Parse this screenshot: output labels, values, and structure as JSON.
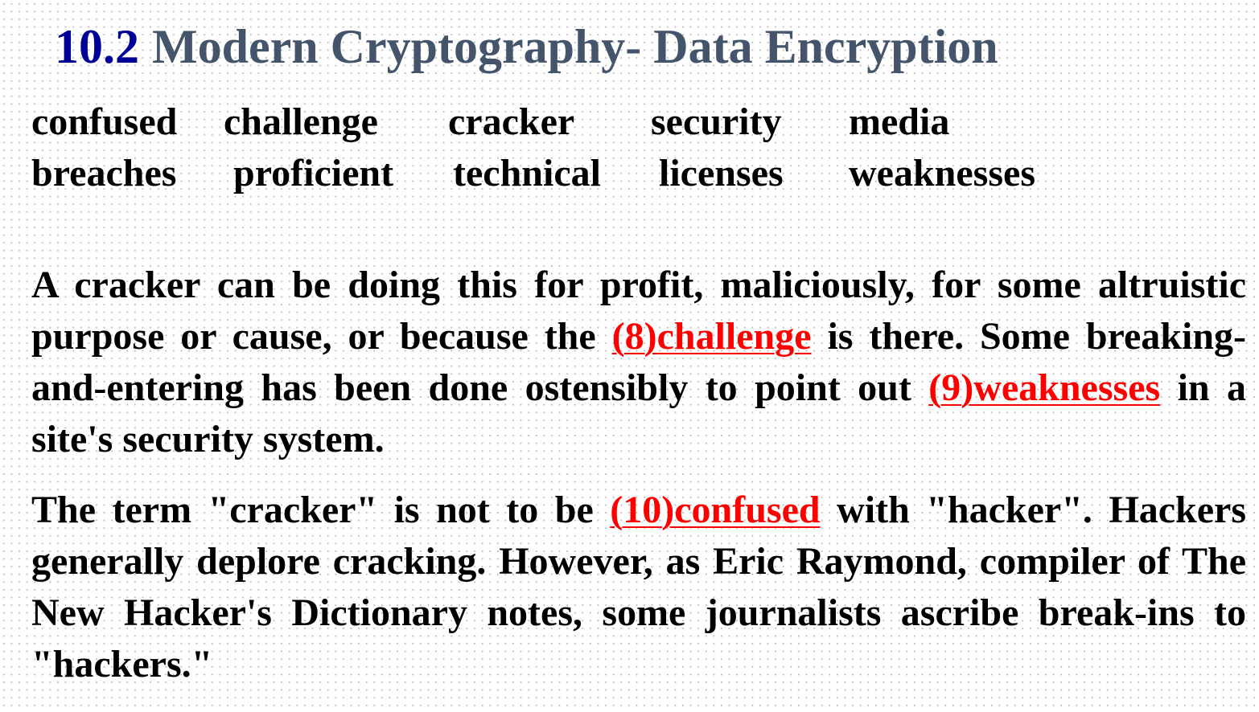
{
  "title": {
    "number": "10.2",
    "text": "Modern Cryptography- Data Encryption"
  },
  "word_bank": {
    "row1": [
      "confused",
      "challenge",
      "cracker",
      "security",
      "media"
    ],
    "row2": [
      "breaches",
      "proficient",
      "technical",
      "licenses",
      "weaknesses"
    ]
  },
  "paragraph1": {
    "part1": "A cracker can be doing this for profit, maliciously, for some altruistic purpose or cause, or because the ",
    "blank8": "(8)challenge",
    "part2": " is there. Some breaking-and-entering has been done ostensibly to point out ",
    "blank9": "(9)weaknesses",
    "part3": " in a site's security system."
  },
  "paragraph2": {
    "part1": "The term \"cracker\" is not to be ",
    "blank10": "(10)confused",
    "part2": " with \"hacker\". Hackers generally deplore cracking. However, as Eric Raymond, compiler of The New Hacker's Dictionary notes, some journalists ascribe break-ins to \"hackers.\""
  },
  "colors": {
    "title_number": "#000099",
    "title_text": "#44546a",
    "answer": "#ff0000",
    "body": "#000000"
  }
}
